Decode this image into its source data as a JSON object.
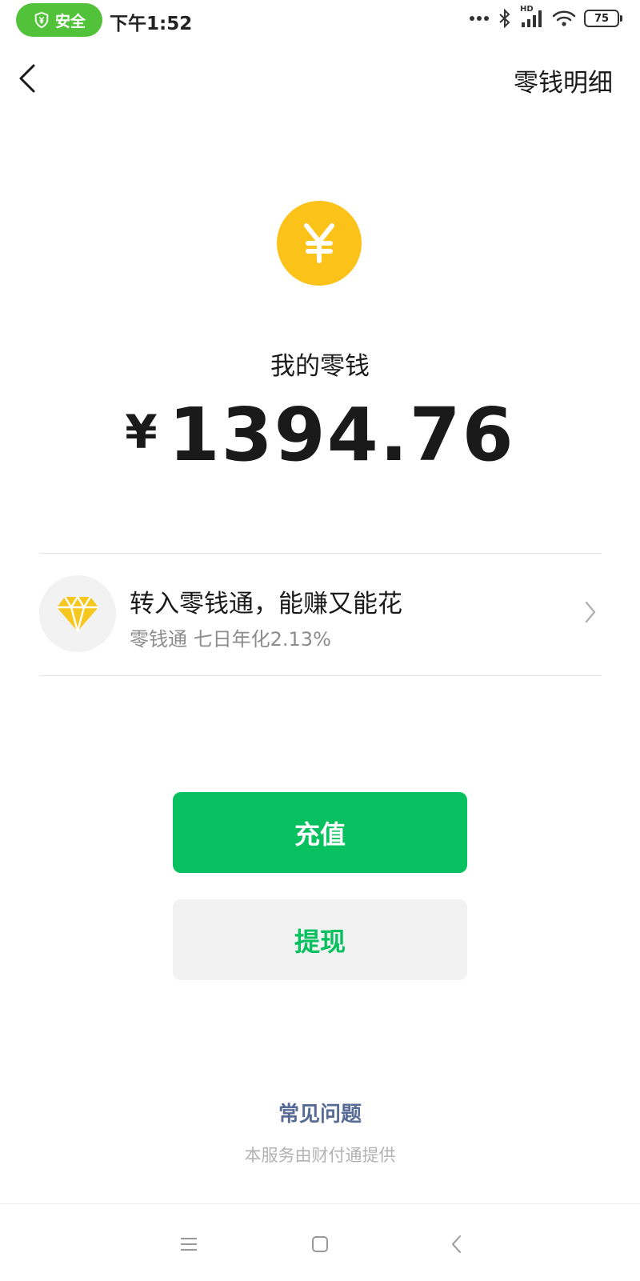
{
  "status_bar": {
    "safe_label": "安全",
    "time": "下午1:52",
    "network_label": "HD",
    "battery_level": "75"
  },
  "nav": {
    "back_icon": "chevron-left-icon",
    "details_label": "零钱明细"
  },
  "balance": {
    "coin_icon": "yuan-coin-icon",
    "label": "我的零钱",
    "currency_symbol": "¥",
    "amount": "1394.76"
  },
  "promo": {
    "icon": "diamond-icon",
    "title": "转入零钱通，能赚又能花",
    "subtitle": "零钱通 七日年化2.13%"
  },
  "actions": {
    "recharge_label": "充值",
    "withdraw_label": "提现"
  },
  "footer": {
    "faq_label": "常见问题",
    "provider_text": "本服务由财付通提供"
  },
  "colors": {
    "primary_green": "#07c160",
    "coin_yellow": "#fbc219",
    "safe_green": "#53c23b",
    "link_blue": "#576b95"
  }
}
